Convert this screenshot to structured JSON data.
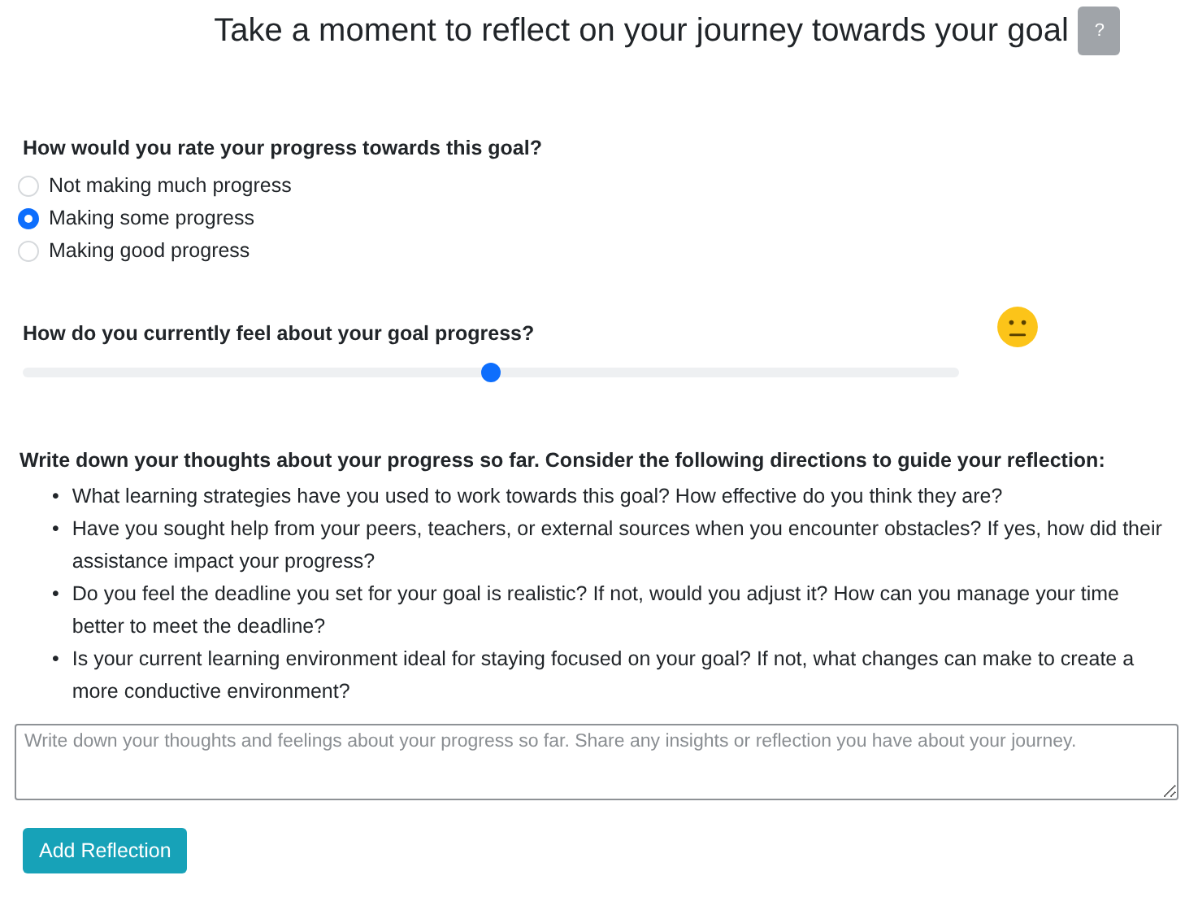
{
  "title": "Take a moment to reflect on your journey towards your goal",
  "help_button": "?",
  "rating": {
    "question": "How would you rate your progress towards this goal?",
    "options": [
      {
        "label": "Not making much progress",
        "selected": false
      },
      {
        "label": "Making some progress",
        "selected": true
      },
      {
        "label": "Making good progress",
        "selected": false
      }
    ]
  },
  "feeling": {
    "question": "How do you currently feel about your goal progress?",
    "level": 0.5
  },
  "reflection": {
    "prompt": "Write down your thoughts about your progress so far. Consider the following directions to guide your reflection:",
    "directions": [
      {
        "marker": "•",
        "text": "What learning strategies have you used to work towards this goal? How effective do you think they are?"
      },
      {
        "marker": "•",
        "text": "Have you sought help from your peers, teachers, or external sources when you encounter obstacles? If yes, how did their assistance impact your progress?"
      },
      {
        "marker": "•",
        "text": "Do you feel the deadline you set for your goal is realistic? If not, would you adjust it? How can you manage your time better to meet the deadline?"
      },
      {
        "marker": "•",
        "text": "Is your current learning environment ideal for staying focused on your goal? If not, what changes can make to create a more conductive environment?"
      }
    ],
    "placeholder": "Write down your thoughts and feelings about your progress so far. Share any insights or reflection you have about your journey."
  },
  "submit_button": "Add Reflection"
}
